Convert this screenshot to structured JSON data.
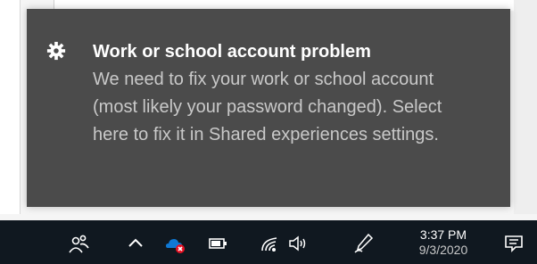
{
  "notification": {
    "icon": "gear-icon",
    "title": "Work or school account problem",
    "message": "We need to fix your work or school account (most likely your password changed). Select here to fix it in Shared experiences settings."
  },
  "taskbar": {
    "icons": [
      "people-icon",
      "chevron-up-icon",
      "onedrive-error-icon",
      "battery-icon",
      "wifi-icon",
      "volume-icon",
      "pen-icon",
      "notification-center-icon"
    ],
    "time": "3:37 PM",
    "date": "9/3/2020"
  },
  "colors": {
    "toast_background": "#4b4b4b",
    "taskbar_background": "#101820",
    "onedrive_blue": "#0f78d4",
    "error_red": "#e81123"
  }
}
